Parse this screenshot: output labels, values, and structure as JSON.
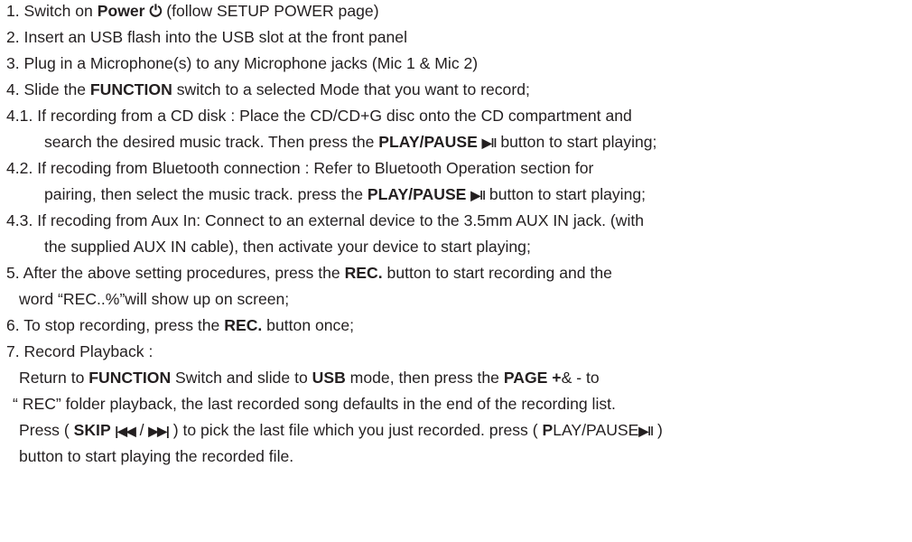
{
  "lines": {
    "l1": {
      "a": "1. Switch on ",
      "b": "Power",
      "c": " (follow SETUP POWER page)",
      "icon": "⏻"
    },
    "l2": {
      "a": "2. Insert an USB flash into the USB slot at the front panel"
    },
    "l3": {
      "a": "3. Plug in a Microphone(s) to any  Microphone jacks (Mic 1 & Mic 2)"
    },
    "l4": {
      "a": "4. Slide the ",
      "b": "FUNCTION",
      "c": " switch to a selected Mode that you want to record;"
    },
    "l5": {
      "a": "4.1. If recording from a CD disk : Place the CD/CD+G disc onto the CD compartment and"
    },
    "l6": {
      "a": "search the desired music track. Then press the ",
      "b": "PLAY/PAUSE ",
      "icon": "▶ǁ",
      "c": " button to start playing;"
    },
    "l7": {
      "a": "4.2. If recoding from Bluetooth connection : Refer to Bluetooth Operation section for"
    },
    "l8": {
      "a": "pairing, then select  the music track. press the ",
      "b": "PLAY/PAUSE ",
      "icon": "▶ǁ",
      "c": " button to start playing;"
    },
    "l9": {
      "a": "4.3. If recoding from Aux In: Connect to an external device to the 3.5mm AUX IN jack. (with"
    },
    "l10": {
      "a": "the supplied AUX IN cable), then activate your device to start playing;"
    },
    "l11": {
      "a": "5. After the above setting procedures, press the ",
      "b": "REC.",
      "c": " button to start recording and the"
    },
    "l12": {
      "a": "word  “REC..%”will show up on screen;"
    },
    "l13": {
      "a": "6. To stop recording, press the ",
      "b": "REC.",
      "c": " button once;"
    },
    "l14": {
      "a": "7. Record Playback :"
    },
    "l15": {
      "a": "Return to ",
      "b": "FUNCTION",
      "c": " Switch and slide to ",
      "d": "USB",
      "e": " mode, then press the ",
      "f": "PAGE +",
      "g": "& -  to"
    },
    "l16": {
      "a": "“ REC” folder playback, the last recorded song defaults in the end of the recording list."
    },
    "l17": {
      "a": "Press ( ",
      "b": "SKIP ",
      "icon1": "|◀◀",
      "c": "  / ",
      "icon2": "▶▶|",
      "d": " )  to pick the last file which you just recorded. press ( ",
      "e": "P",
      "f": "LAY/PAUSE",
      "icon3": "▶ǁ",
      "g": " )"
    },
    "l18": {
      "a": "button to start playing the recorded file."
    }
  }
}
